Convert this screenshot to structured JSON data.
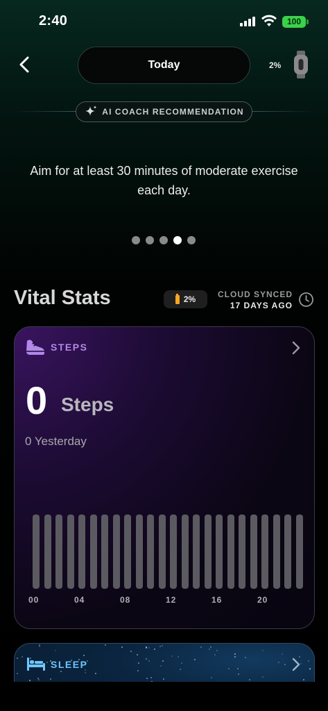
{
  "status_bar": {
    "time": "2:40",
    "battery": "100"
  },
  "header": {
    "back_icon": "chevron-left-icon",
    "date_label": "Today",
    "device_battery": "2%",
    "device_icon": "watch-icon"
  },
  "coach": {
    "chip_label": "AI COACH RECOMMENDATION",
    "chip_icon": "sparkle-icon",
    "message": "Aim for at least 30 minutes of moderate exercise each day.",
    "page_count": 5,
    "active_page": 4
  },
  "vital_stats": {
    "title": "Vital Stats",
    "battery_badge": "2%",
    "sync_label": "CLOUD SYNCED",
    "sync_date": "17 DAYS AGO",
    "sync_icon": "clock-icon"
  },
  "steps_card": {
    "label": "STEPS",
    "icon": "sneaker-icon",
    "value": "0",
    "unit": "Steps",
    "yesterday": "0 Yesterday",
    "hour_ticks": [
      "00",
      "04",
      "08",
      "12",
      "16",
      "20"
    ],
    "hourly_values": [
      0,
      0,
      0,
      0,
      0,
      0,
      0,
      0,
      0,
      0,
      0,
      0,
      0,
      0,
      0,
      0,
      0,
      0,
      0,
      0,
      0,
      0,
      0,
      0
    ]
  },
  "sleep_card": {
    "label": "SLEEP",
    "icon": "bed-icon"
  },
  "colors": {
    "steps_accent": "#b487ea",
    "sleep_accent": "#6ec6ff",
    "battery_green": "#3bd24b",
    "battery_low": "#f5a623"
  }
}
